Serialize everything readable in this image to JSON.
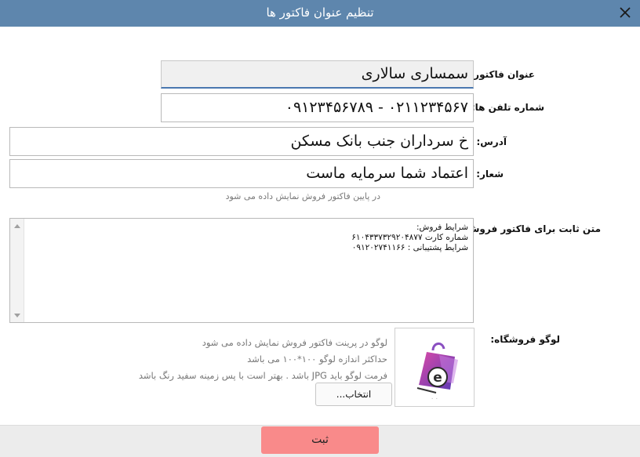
{
  "window": {
    "title": "تنظیم عنوان فاکتور ها",
    "title_bar_color": "#5e86ad",
    "close_icon": "close-icon"
  },
  "form": {
    "invoice_title": {
      "label": "عنوان فاکتور:",
      "value": "سمساری سالاری"
    },
    "phones": {
      "label": "شماره تلفن ها:",
      "value": "۰۲۱۱۲۳۴۵۶۷ - ۰۹۱۲۳۴۵۶۷۸۹"
    },
    "address": {
      "label": "آدرس:",
      "value": "خ سرداران جنب بانک مسکن"
    },
    "slogan": {
      "label": "شعار:",
      "value": "اعتماد شما سرمایه ماست",
      "hint": "در پایین فاکتور فروش نمایش داده می شود"
    },
    "fixed_text": {
      "label": "متن ثابت برای فاکتور فروش:",
      "lines": [
        "شرایط فروش:",
        "شماره کارت ۶۱۰۴۳۳۷۳۲۹۲۰۴۸۷۷",
        "شرایط پشتیبانی : ۰۹۱۲۰۲۷۴۱۱۶۶"
      ]
    },
    "logo": {
      "label": "لوگو فروشگاه:",
      "info_lines": [
        "لوگو در پرینت فاکتور فروش نمایش داده می شود",
        "حداکثر اندازه لوگو ۱۰۰*۱۰۰ می باشد",
        "فرمت لوگو باید JPG باشد . بهتر است با پس زمینه سفید رنگ باشد"
      ],
      "choose_label": "انتخاب...",
      "logo_letter": "e",
      "logo_icon": "shopping-bag-logo-icon"
    }
  },
  "footer": {
    "submit_label": "ثبت",
    "submit_color": "#f98a8a"
  }
}
